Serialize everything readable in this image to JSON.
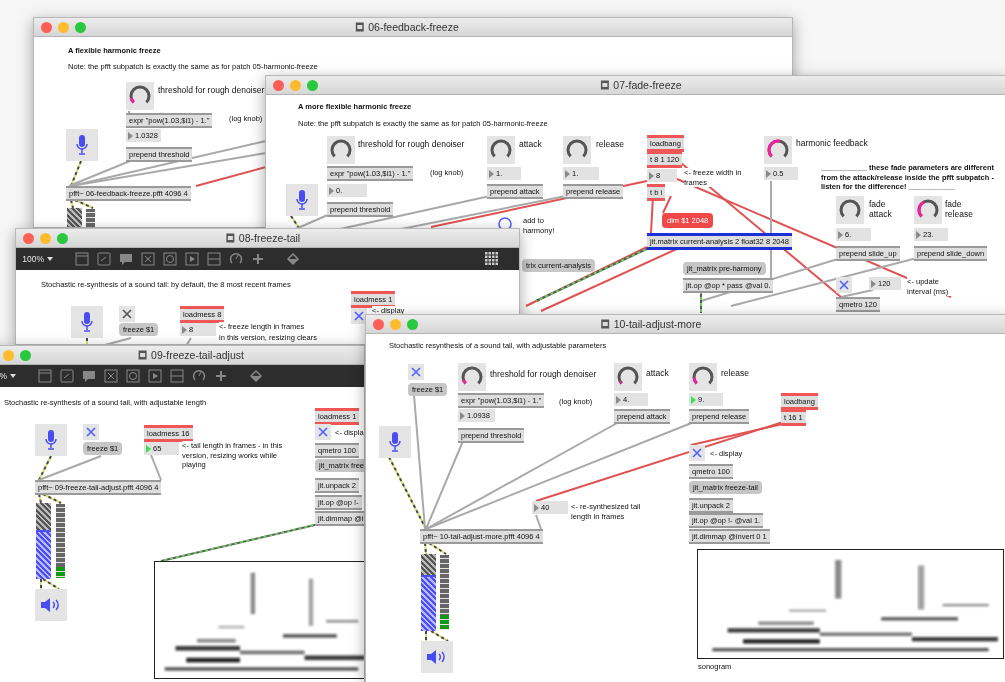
{
  "windows": [
    {
      "title": "06-feedback-freeze",
      "items": [
        {
          "kind": "heading",
          "text": "A flexible harmonic freeze"
        },
        {
          "kind": "comment",
          "text": "Note: the pfft subpatch is exactly the same as for patch 05-harmonic-freeze"
        },
        {
          "kind": "knob"
        },
        {
          "kind": "label",
          "text": "threshold for rough denoiser"
        },
        {
          "kind": "object",
          "text": "expr \"pow(1.03,$i1) - 1.\""
        },
        {
          "kind": "comment",
          "text": "(log knob)"
        },
        {
          "kind": "number",
          "text": "1.0328",
          "active": false
        },
        {
          "kind": "object",
          "text": "prepend threshold"
        },
        {
          "kind": "mic"
        },
        {
          "kind": "object",
          "text": "pfft~ 06-feedback-freeze.pfft 4096 4"
        },
        {
          "kind": "gain"
        },
        {
          "kind": "levelmeter"
        }
      ]
    },
    {
      "title": "07-fade-freeze",
      "items": [
        {
          "kind": "heading",
          "text": "A more flexible harmonic freeze"
        },
        {
          "kind": "comment",
          "text": "Note: the pfft subpatch is exactly the same as for patch 05-harmonic-freeze"
        },
        {
          "kind": "knob"
        },
        {
          "kind": "label",
          "text": "threshold for rough denoiser"
        },
        {
          "kind": "object",
          "text": "expr \"pow(1.03,$i1) - 1.\""
        },
        {
          "kind": "comment",
          "text": "(log knob)"
        },
        {
          "kind": "number",
          "text": "0.",
          "active": false
        },
        {
          "kind": "object",
          "text": "prepend threshold"
        },
        {
          "kind": "mic"
        },
        {
          "kind": "knob"
        },
        {
          "kind": "label",
          "text": "attack"
        },
        {
          "kind": "number",
          "text": "1.",
          "active": false
        },
        {
          "kind": "object",
          "text": "prepend attack"
        },
        {
          "kind": "knob"
        },
        {
          "kind": "label",
          "text": "release"
        },
        {
          "kind": "number",
          "text": "1.",
          "active": false
        },
        {
          "kind": "object",
          "text": "prepend release"
        },
        {
          "kind": "accent",
          "text": "loadbang"
        },
        {
          "kind": "accent",
          "text": "t 8 1 120"
        },
        {
          "kind": "number",
          "text": "8",
          "active": false
        },
        {
          "kind": "comment",
          "text": "<- freeze width in frames"
        },
        {
          "kind": "accent",
          "text": "t b i"
        },
        {
          "kind": "accentmessage",
          "text": "dim $1 2048"
        },
        {
          "kind": "matrix",
          "text": "jit.matrix current-analysis 2 float32 8 2048"
        },
        {
          "kind": "knob"
        },
        {
          "kind": "label",
          "text": "harmonic feedback"
        },
        {
          "kind": "number",
          "text": "0.5",
          "active": false
        },
        {
          "kind": "heading",
          "text": "___________ these fade parameters are different from the attack/release inside the pfft subpatch - listen for the difference! ___________"
        },
        {
          "kind": "knob"
        },
        {
          "kind": "label",
          "text": "fade attack"
        },
        {
          "kind": "knob"
        },
        {
          "kind": "label",
          "text": "fade release"
        },
        {
          "kind": "number",
          "text": "6.",
          "active": false
        },
        {
          "kind": "number",
          "text": "23.",
          "active": false
        },
        {
          "kind": "object",
          "text": "prepend slide_up"
        },
        {
          "kind": "object",
          "text": "prepend slide_down"
        },
        {
          "kind": "bang"
        },
        {
          "kind": "comment",
          "text": "add to harmony!"
        },
        {
          "kind": "message",
          "text": "trix current-analysis"
        },
        {
          "kind": "message",
          "text": "jit_matrix pre-harmony"
        },
        {
          "kind": "object",
          "text": "jit.op @op * pass @val 0."
        },
        {
          "kind": "toggle",
          "checked": true,
          "color": "#5060ff"
        },
        {
          "kind": "number",
          "text": "120",
          "active": false
        },
        {
          "kind": "comment",
          "text": "<- update interval (ms)"
        },
        {
          "kind": "object",
          "text": "qmetro 120"
        }
      ]
    },
    {
      "title": "08-freeze-tail",
      "toolbar": {
        "zoom": "100%",
        "grid_button": true
      },
      "items": [
        {
          "kind": "comment",
          "text": "Stochastic re-synthesis of a sound tail: by default, the 8 most recent frames"
        },
        {
          "kind": "mic"
        },
        {
          "kind": "toggle",
          "checked": true,
          "color": "#555555"
        },
        {
          "kind": "message",
          "text": "freeze $1"
        },
        {
          "kind": "accent",
          "text": "loadmess 8"
        },
        {
          "kind": "number",
          "text": "8",
          "active": false
        },
        {
          "kind": "comment",
          "text": "<- freeze length in frames"
        },
        {
          "kind": "comment",
          "text": "in this version, resizing clears"
        },
        {
          "kind": "accent",
          "text": "loadmess 1"
        },
        {
          "kind": "toggle",
          "checked": true,
          "color": "#5060ff"
        },
        {
          "kind": "comment",
          "text": "<- display"
        }
      ]
    },
    {
      "title": "09-freeze-tail-adjust",
      "toolbar": {
        "zoom": "%"
      },
      "items": [
        {
          "kind": "comment",
          "text": "Stochastic re-synthesis of a sound tail, with adjustable length"
        },
        {
          "kind": "mic"
        },
        {
          "kind": "toggle",
          "checked": true,
          "color": "#5060ff"
        },
        {
          "kind": "message",
          "text": "freeze $1"
        },
        {
          "kind": "accent",
          "text": "loadmess 16"
        },
        {
          "kind": "number",
          "text": "65",
          "active": true
        },
        {
          "kind": "comment",
          "text": "<- tail length in frames - in this version, resizing works while playing"
        },
        {
          "kind": "object",
          "text": "pfft~ 09-freeze-tail-adjust.pfft 4096 4"
        },
        {
          "kind": "gain",
          "level": 0.62
        },
        {
          "kind": "levelmeter",
          "level": 0.15
        },
        {
          "kind": "speaker"
        },
        {
          "kind": "accent",
          "text": "loadmess 1"
        },
        {
          "kind": "toggle",
          "checked": true,
          "color": "#5060ff"
        },
        {
          "kind": "comment",
          "text": "<- displa"
        },
        {
          "kind": "object",
          "text": "qmetro 100"
        },
        {
          "kind": "message",
          "text": "jit_matrix free"
        },
        {
          "kind": "object",
          "text": "jit.unpack 2"
        },
        {
          "kind": "object",
          "text": "jit.op @op !-"
        },
        {
          "kind": "object",
          "text": "jit.dimmap @i"
        },
        {
          "kind": "sonogram"
        }
      ]
    },
    {
      "title": "10-tail-adjust-more",
      "items": [
        {
          "kind": "comment",
          "text": "Stochastic resynthesis of a sound tail, with adjustable parameters"
        },
        {
          "kind": "toggle",
          "checked": true,
          "color": "#5060ff"
        },
        {
          "kind": "message",
          "text": "freeze $1"
        },
        {
          "kind": "knob"
        },
        {
          "kind": "label",
          "text": "threshold for rough denoiser"
        },
        {
          "kind": "object",
          "text": "expr \"pow(1.03,$i1) - 1.\""
        },
        {
          "kind": "comment",
          "text": "(log knob)"
        },
        {
          "kind": "number",
          "text": "1.0938",
          "active": false
        },
        {
          "kind": "object",
          "text": "prepend threshold"
        },
        {
          "kind": "knob"
        },
        {
          "kind": "label",
          "text": "attack"
        },
        {
          "kind": "number",
          "text": "4.",
          "active": false
        },
        {
          "kind": "object",
          "text": "prepend attack"
        },
        {
          "kind": "knob"
        },
        {
          "kind": "label",
          "text": "release"
        },
        {
          "kind": "number",
          "text": "9.",
          "active": true
        },
        {
          "kind": "object",
          "text": "prepend release"
        },
        {
          "kind": "mic"
        },
        {
          "kind": "accent",
          "text": "loadbang"
        },
        {
          "kind": "accent",
          "text": "t 16 1"
        },
        {
          "kind": "toggle",
          "checked": true,
          "color": "#5060ff"
        },
        {
          "kind": "comment",
          "text": "<- display"
        },
        {
          "kind": "object",
          "text": "qmetro 100"
        },
        {
          "kind": "message",
          "text": "jit_matrix freeze-tail"
        },
        {
          "kind": "object",
          "text": "jit.unpack 2"
        },
        {
          "kind": "object",
          "text": "jit.op @op !- @val 1."
        },
        {
          "kind": "object",
          "text": "jit.dimmap @invert 0 1"
        },
        {
          "kind": "number",
          "text": "40",
          "active": false
        },
        {
          "kind": "comment",
          "text": "<- re-synthesized tail length in frames"
        },
        {
          "kind": "object",
          "text": "pfft~ 10-tail-adjust-more.pfft 4096 4"
        },
        {
          "kind": "gain",
          "level": 0.7
        },
        {
          "kind": "levelmeter",
          "level": 0.2
        },
        {
          "kind": "speaker"
        },
        {
          "kind": "sonogram"
        },
        {
          "kind": "comment",
          "text": "sonogram"
        }
      ]
    }
  ]
}
